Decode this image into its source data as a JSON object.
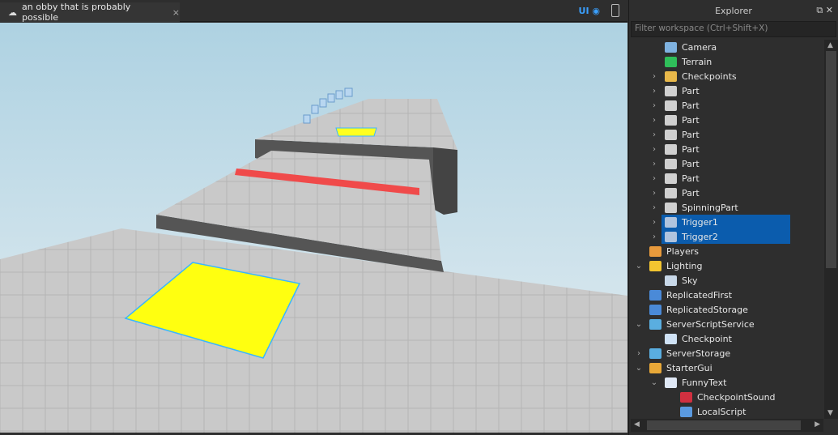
{
  "tab": {
    "title": "an obby that is probably possible",
    "close": "×"
  },
  "toolbar": {
    "ui_label": "UI"
  },
  "explorer": {
    "title": "Explorer",
    "filter_placeholder": "Filter workspace (Ctrl+Shift+X)",
    "items": [
      {
        "label": "Camera",
        "level": 2,
        "chev": "",
        "icon": "camera-icon",
        "color": "#7fb2e0"
      },
      {
        "label": "Terrain",
        "level": 2,
        "chev": "",
        "icon": "terrain-icon",
        "color": "#2fbf5a"
      },
      {
        "label": "Checkpoints",
        "level": 2,
        "chev": ">",
        "icon": "folder-icon",
        "color": "#e8b84a"
      },
      {
        "label": "Part",
        "level": 2,
        "chev": ">",
        "icon": "part-icon",
        "color": "#d0d0d0"
      },
      {
        "label": "Part",
        "level": 2,
        "chev": ">",
        "icon": "part-icon",
        "color": "#d0d0d0"
      },
      {
        "label": "Part",
        "level": 2,
        "chev": ">",
        "icon": "part-icon",
        "color": "#d0d0d0"
      },
      {
        "label": "Part",
        "level": 2,
        "chev": ">",
        "icon": "part-icon",
        "color": "#d0d0d0"
      },
      {
        "label": "Part",
        "level": 2,
        "chev": ">",
        "icon": "part-icon",
        "color": "#d0d0d0"
      },
      {
        "label": "Part",
        "level": 2,
        "chev": ">",
        "icon": "part-icon",
        "color": "#d0d0d0"
      },
      {
        "label": "Part",
        "level": 2,
        "chev": ">",
        "icon": "part-icon",
        "color": "#d0d0d0"
      },
      {
        "label": "Part",
        "level": 2,
        "chev": ">",
        "icon": "part-icon",
        "color": "#d0d0d0"
      },
      {
        "label": "SpinningPart",
        "level": 2,
        "chev": ">",
        "icon": "part-icon",
        "color": "#d0d0d0"
      },
      {
        "label": "Trigger1",
        "level": 2,
        "chev": ">",
        "icon": "part-icon",
        "color": "#b0c4de",
        "selected": true
      },
      {
        "label": "Trigger2",
        "level": 2,
        "chev": ">",
        "icon": "part-icon",
        "color": "#b0c4de",
        "selected": true
      },
      {
        "label": "Players",
        "level": 1,
        "chev": "",
        "icon": "players-icon",
        "color": "#e89a3c"
      },
      {
        "label": "Lighting",
        "level": 1,
        "chev": "v",
        "icon": "lightbulb-icon",
        "color": "#f3c530"
      },
      {
        "label": "Sky",
        "level": 2,
        "chev": "",
        "icon": "sky-icon",
        "color": "#c8d8e8"
      },
      {
        "label": "ReplicatedFirst",
        "level": 1,
        "chev": "",
        "icon": "replicated-first-icon",
        "color": "#4a8ad8"
      },
      {
        "label": "ReplicatedStorage",
        "level": 1,
        "chev": "",
        "icon": "replicated-storage-icon",
        "color": "#4a8ad8"
      },
      {
        "label": "ServerScriptService",
        "level": 1,
        "chev": "v",
        "icon": "server-script-service-icon",
        "color": "#5aaee0"
      },
      {
        "label": "Checkpoint",
        "level": 2,
        "chev": "",
        "icon": "script-icon",
        "color": "#cfe2f5"
      },
      {
        "label": "ServerStorage",
        "level": 1,
        "chev": ">",
        "icon": "server-storage-icon",
        "color": "#5aaee0"
      },
      {
        "label": "StarterGui",
        "level": 1,
        "chev": "v",
        "icon": "starter-gui-icon",
        "color": "#e8a838"
      },
      {
        "label": "FunnyText",
        "level": 2,
        "chev": "v",
        "icon": "screen-gui-icon",
        "color": "#dfe8f5"
      },
      {
        "label": "CheckpointSound",
        "level": 3,
        "chev": "",
        "icon": "sound-icon",
        "color": "#d03040"
      },
      {
        "label": "LocalScript",
        "level": 3,
        "chev": "",
        "icon": "local-script-icon",
        "color": "#5a9ae0"
      }
    ]
  }
}
